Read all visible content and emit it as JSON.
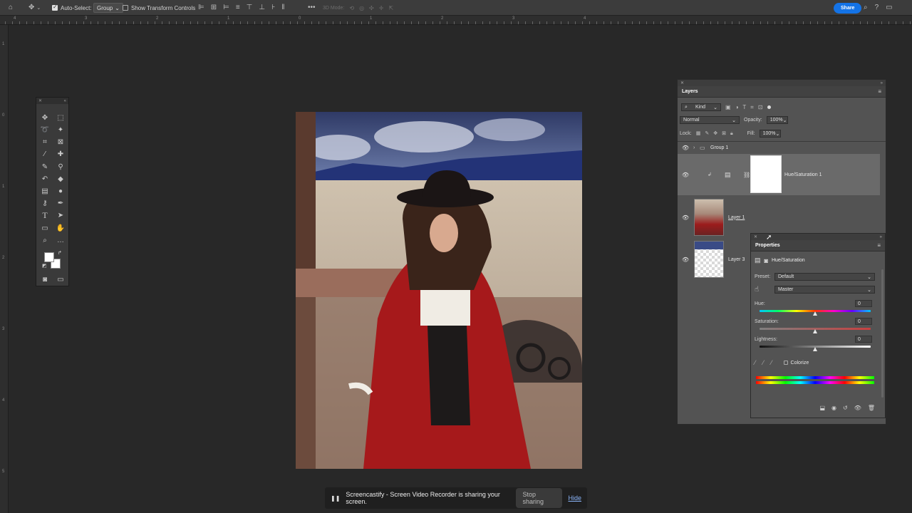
{
  "options_bar": {
    "auto_select_label": "Auto-Select:",
    "auto_select_mode": "Group",
    "show_transform_label": "Show Transform Controls",
    "mode_3d_label": "3D Mode:",
    "share_label": "Share"
  },
  "ruler": {
    "labels": [
      "4",
      "3",
      "2",
      "1",
      "0",
      "1",
      "2",
      "3",
      "4"
    ],
    "vertical_labels": [
      "1",
      "0",
      "1",
      "2",
      "3",
      "4",
      "5"
    ]
  },
  "layers_panel": {
    "title": "Layers",
    "filter_label": "Kind",
    "blend_mode": "Normal",
    "opacity_label": "Opacity:",
    "opacity_value": "100%",
    "lock_label": "Lock:",
    "fill_label": "Fill:",
    "fill_value": "100%",
    "layers": [
      {
        "name": "Group 1",
        "type": "group"
      },
      {
        "name": "Hue/Saturation 1",
        "type": "adjustment"
      },
      {
        "name": "Layer 1",
        "type": "pixel"
      },
      {
        "name": "Layer 3",
        "type": "pixel"
      }
    ]
  },
  "properties_panel": {
    "title": "Properties",
    "adjustment_name": "Hue/Saturation",
    "preset_label": "Preset:",
    "preset_value": "Default",
    "channel_value": "Master",
    "hue_label": "Hue:",
    "hue_value": "0",
    "saturation_label": "Saturation:",
    "saturation_value": "0",
    "lightness_label": "Lightness:",
    "lightness_value": "0",
    "colorize_label": "Colorize"
  },
  "share_notice": {
    "message": "Screencastify - Screen Video Recorder is sharing your screen.",
    "stop_label": "Stop sharing",
    "hide_label": "Hide"
  },
  "colors": {
    "accent": "#1473e6",
    "panel": "#535353",
    "workspace": "#282828"
  }
}
